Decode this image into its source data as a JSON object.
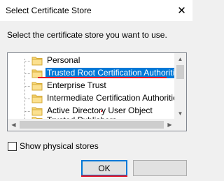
{
  "dialog": {
    "title": "Select Certificate Store",
    "close_glyph": "✕",
    "instruction": "Select the certificate store you want to use."
  },
  "tree": {
    "items": [
      {
        "label": "Personal",
        "icon": "folder-icon",
        "selected": false
      },
      {
        "label": "Trusted Root Certification Authorities",
        "icon": "folder-icon",
        "selected": true
      },
      {
        "label": "Enterprise Trust",
        "icon": "folder-icon",
        "selected": false
      },
      {
        "label": "Intermediate Certification Authorities",
        "icon": "folder-icon",
        "selected": false
      },
      {
        "label": "Active Directory User Object",
        "icon": "folder-icon",
        "selected": false
      },
      {
        "label": "Trusted Publishers",
        "icon": "folder-icon",
        "selected": false
      }
    ],
    "scroll_up_glyph": "▲",
    "scroll_down_glyph": "▼",
    "scroll_left_glyph": "◀",
    "scroll_right_glyph": "▶"
  },
  "show_physical_stores": {
    "label": "Show physical stores",
    "checked": false
  },
  "buttons": {
    "ok": "OK",
    "cancel": ""
  },
  "colors": {
    "selection": "#0078d7",
    "annotation_red": "#e81123",
    "folder_fill": "#f8d775",
    "folder_edge": "#d4a936"
  }
}
